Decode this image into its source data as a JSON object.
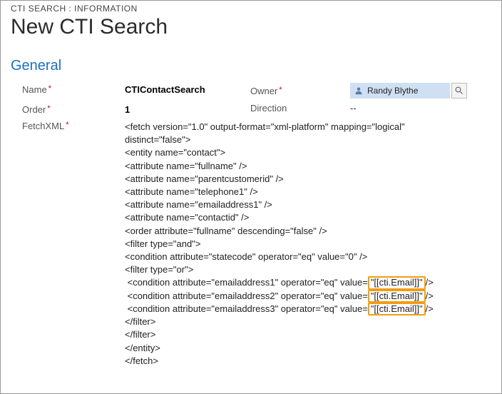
{
  "breadcrumb": "CTI SEARCH : INFORMATION",
  "page_title": "New CTI Search",
  "section": "General",
  "fields": {
    "name_label": "Name",
    "name_value": "CTIContactSearch",
    "order_label": "Order",
    "order_value": "1",
    "owner_label": "Owner",
    "owner_value": "Randy Blythe",
    "direction_label": "Direction",
    "direction_value": "--",
    "fetchxml_label": "FetchXML"
  },
  "fetchxml": {
    "l0": "<fetch version=\"1.0\" output-format=\"xml-platform\" mapping=\"logical\"",
    "l0b": "distinct=\"false\">",
    "l1": "<entity name=\"contact\">",
    "l2": "<attribute name=\"fullname\" />",
    "l3": "<attribute name=\"parentcustomerid\" />",
    "l4": "<attribute name=\"telephone1\" />",
    "l5": "<attribute name=\"emailaddress1\" />",
    "l6": "<attribute name=\"contactid\" />",
    "l7": "<order attribute=\"fullname\" descending=\"false\" />",
    "l8": "<filter type=\"and\">",
    "l9": "<condition attribute=\"statecode\" operator=\"eq\" value=\"0\" />",
    "l10": "<filter type=\"or\">",
    "c1a": " <condition attribute=\"emailaddress1\" operator=\"eq\" value=",
    "c1b": "\"[[cti.Email]]\"",
    "c1c": "/>",
    "c2a": " <condition attribute=\"emailaddress2\" operator=\"eq\" value=",
    "c2b": "\"[[cti.Email]]\"",
    "c2c": "/>",
    "c3a": " <condition attribute=\"emailaddress3\" operator=\"eq\" value=",
    "c3b": "\"[[cti.Email]]\"",
    "c3c": "/>",
    "l14": "</filter>",
    "l15": "</filter>",
    "l16": "</entity>",
    "l17": "</fetch>"
  }
}
